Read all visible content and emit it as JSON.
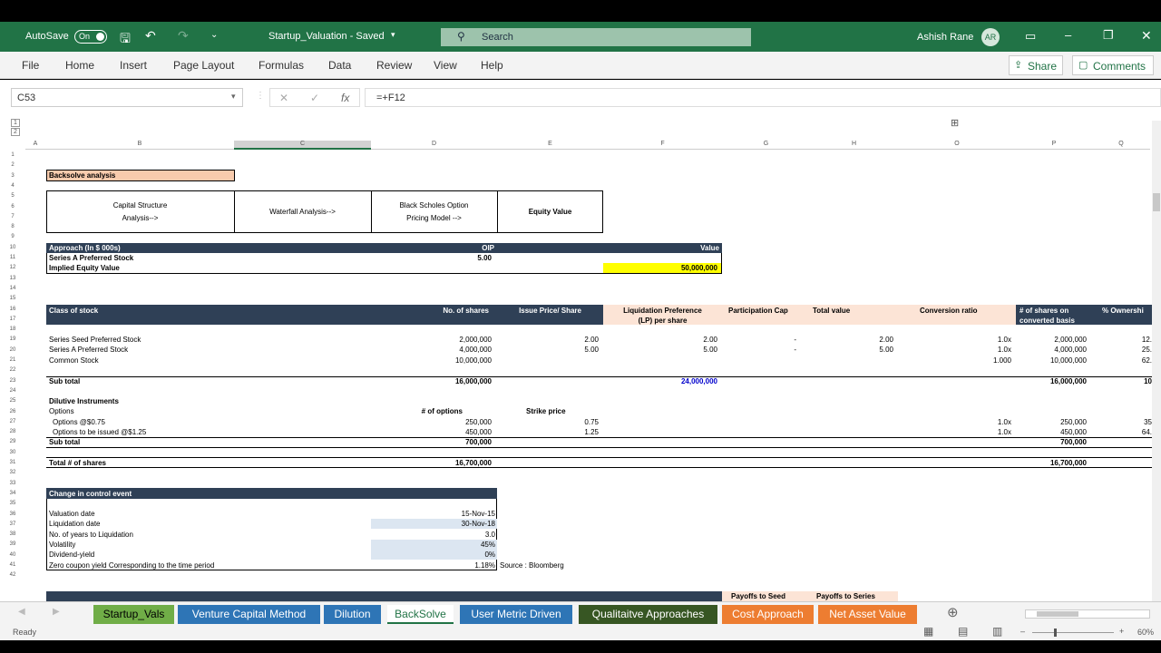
{
  "titlebar": {
    "autosave": "AutoSave",
    "toggle": "On",
    "filename": "Startup_Valuation  -  Saved",
    "search": "Search",
    "user": "Ashish Rane",
    "initials": "AR"
  },
  "ribbon": {
    "tabs": [
      "File",
      "Home",
      "Insert",
      "Page Layout",
      "Formulas",
      "Data",
      "Review",
      "View",
      "Help"
    ],
    "share": "Share",
    "comments": "Comments"
  },
  "formula": {
    "namebox": "C53",
    "cancel": "✕",
    "enter": "✓",
    "fx": "fx",
    "value": "=+F12"
  },
  "columns": [
    "A",
    "B",
    "C",
    "D",
    "E",
    "F",
    "G",
    "H",
    "O",
    "P",
    "Q"
  ],
  "rows": [
    "1",
    "2",
    "3",
    "4",
    "5",
    "6",
    "7",
    "8",
    "9",
    "10",
    "11",
    "12",
    "13",
    "14",
    "15",
    "16",
    "17",
    "18",
    "19",
    "20",
    "21",
    "22",
    "23",
    "24",
    "25",
    "26",
    "27",
    "28",
    "29",
    "30",
    "31",
    "32",
    "33",
    "34",
    "35",
    "36",
    "37",
    "38",
    "39",
    "40",
    "41",
    "42"
  ],
  "sheet": {
    "backsolve": "Backsolve analysis",
    "flow": [
      "Capital Structure",
      "Analysis-->",
      "Waterfall Analysis-->",
      "Black Scholes Option",
      "Pricing Model -->",
      "Equity Value"
    ],
    "approach": {
      "h1": "Approach (In $ 000s)",
      "h2": "OIP",
      "h3": "Value",
      "r1": "Series A Preferred Stock",
      "r1v": "5.00",
      "r2": "Implied Equity Value",
      "r2v": "50,000,000"
    },
    "cap_headers": [
      "Class of stock",
      "No. of shares",
      "Issue  Price/ Share",
      "Liquidation Preference",
      "(LP) per share",
      "Participation Cap",
      "Total value",
      "Conversion ratio",
      "# of shares on",
      "converted basis",
      "% Ownershi"
    ],
    "cap_rows": [
      {
        "name": "Series Seed Preferred Stock",
        "shares": "2,000,000",
        "price": "2.00",
        "lp": "2.00",
        "cap": "-",
        "tv": "2.00",
        "conv": "1.0x",
        "conv_shares": "2,000,000",
        "own": "12."
      },
      {
        "name": "Series A Preferred Stock",
        "shares": "4,000,000",
        "price": "5.00",
        "lp": "5.00",
        "cap": "-",
        "tv": "5.00",
        "conv": "1.0x",
        "conv_shares": "4,000,000",
        "own": "25."
      },
      {
        "name": "Common Stock",
        "shares": "10,000,000",
        "price": "",
        "lp": "",
        "cap": "",
        "tv": "",
        "conv": "1.000",
        "conv_shares": "10,000,000",
        "own": "62."
      }
    ],
    "subtotal": {
      "label": "Sub total",
      "shares": "16,000,000",
      "lp": "24,000,000",
      "conv": "16,000,000",
      "own": "10"
    },
    "dilutive": {
      "title": "Dilutive Instruments",
      "options": "Options",
      "h_opts": "# of options",
      "h_strike": "Strike price",
      "rows": [
        {
          "name": "Options @$0.75",
          "n": "250,000",
          "s": "0.75",
          "c": "1.0x",
          "cs": "250,000",
          "o": "35"
        },
        {
          "name": "Options to be issued @$1.25",
          "n": "450,000",
          "s": "1.25",
          "c": "1.0x",
          "cs": "450,000",
          "o": "64."
        }
      ],
      "subtotal": "Sub total",
      "sub_n": "700,000",
      "sub_cs": "700,000"
    },
    "total": {
      "label": "Total # of shares",
      "shares": "16,700,000",
      "conv": "16,700,000"
    },
    "event": {
      "title": "Change in control event",
      "rows": [
        [
          "Valuation date",
          "15-Nov-15"
        ],
        [
          "Liquidation date",
          "30-Nov-18"
        ],
        [
          "No. of years to Liquidation",
          "3.0"
        ],
        [
          "Volatility",
          "45%"
        ],
        [
          "Dividend-yield",
          "0%"
        ],
        [
          "Zero coupon yield Corresponding to the time period",
          "1.18%"
        ]
      ],
      "source": "Source : Bloomberg"
    },
    "payoffs": [
      "Payoffs to Seed",
      "Payoffs to Series"
    ]
  },
  "tabs": [
    {
      "label": "Startup_Vals",
      "color": "#70ad47",
      "text": "#000"
    },
    {
      "label": "Venture Capital Method",
      "color": "#2e75b6",
      "text": "#fff"
    },
    {
      "label": "Dilution",
      "color": "#2e75b6",
      "text": "#fff"
    },
    {
      "label": "BackSolve",
      "color": "#ffffff",
      "text": "#217346"
    },
    {
      "label": "User Metric Driven",
      "color": "#2e75b6",
      "text": "#fff"
    },
    {
      "label": "Qualitaitve Approaches",
      "color": "#375623",
      "text": "#fff"
    },
    {
      "label": "Cost Approach",
      "color": "#ed7d31",
      "text": "#fff"
    },
    {
      "label": "Net Asset Value",
      "color": "#ed7d31",
      "text": "#fff"
    }
  ],
  "status": {
    "ready": "Ready",
    "zoom": "60%"
  }
}
